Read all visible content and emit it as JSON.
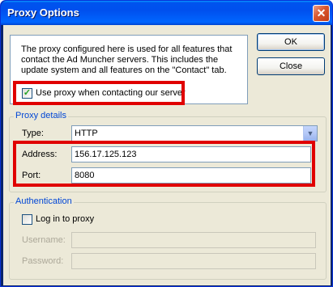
{
  "window": {
    "title": "Proxy Options",
    "close_glyph": "✕"
  },
  "info": {
    "text": "The proxy configured here is used for all features that contact the Ad Muncher servers. This includes the update system and all features on the \"Contact\" tab."
  },
  "buttons": {
    "ok_label": "OK",
    "close_label": "Close"
  },
  "use_proxy": {
    "label": "Use proxy when contacting our server",
    "checked": true,
    "check_glyph": "✓"
  },
  "proxy_details": {
    "group_label": "Proxy details",
    "type_label": "Type:",
    "type_value": "HTTP",
    "address_label": "Address:",
    "address_value": "156.17.125.123",
    "port_label": "Port:",
    "port_value": "8080"
  },
  "authentication": {
    "group_label": "Authentication",
    "login_label": "Log in to proxy",
    "login_checked": false,
    "username_label": "Username:",
    "username_value": "",
    "password_label": "Password:",
    "password_value": ""
  },
  "colors": {
    "highlight": "#e00000",
    "group_label": "#0046d5",
    "dialog_bg": "#ece9d8"
  },
  "icons": {
    "dropdown": "chevron-down-icon",
    "close": "close-icon",
    "check": "check-icon"
  }
}
